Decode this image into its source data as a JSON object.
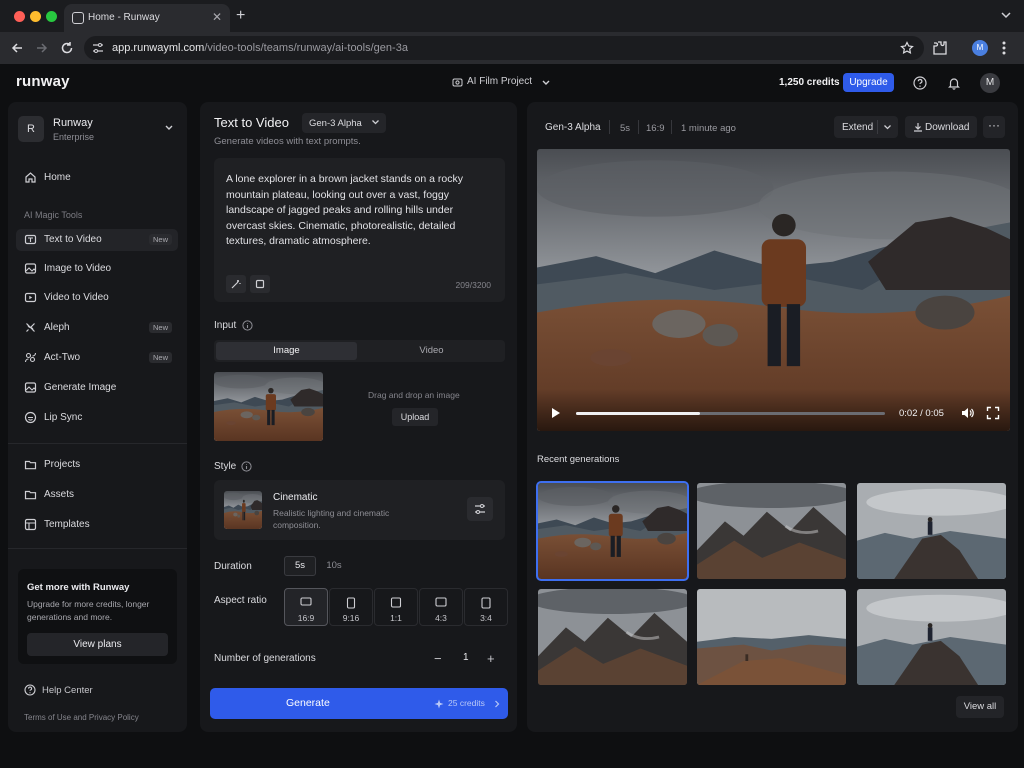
{
  "browser": {
    "tab_title": "Home - Runway",
    "url_host": "app.runwayml.com",
    "url_path": "/video-tools/teams/runway/ai-tools/gen-3a",
    "profile_initial": "M"
  },
  "header": {
    "logo": "runway",
    "project": "AI Film Project",
    "credits": "1,250 credits",
    "upgrade_label": "Upgrade",
    "avatar_initial": "M"
  },
  "sidebar": {
    "workspace_initial": "R",
    "workspace_name": "Runway",
    "workspace_plan": "Enterprise",
    "home_label": "Home",
    "section_label": "AI Magic Tools",
    "tools": [
      {
        "label": "Text to Video",
        "badge": "New",
        "active": true,
        "icon": "text-video-icon"
      },
      {
        "label": "Image to Video",
        "badge": "",
        "active": false,
        "icon": "image-icon"
      },
      {
        "label": "Video to Video",
        "badge": "",
        "active": false,
        "icon": "video-icon"
      },
      {
        "label": "Aleph",
        "badge": "New",
        "active": false,
        "icon": "aleph-icon"
      },
      {
        "label": "Act-Two",
        "badge": "New",
        "active": false,
        "icon": "act-two-icon"
      },
      {
        "label": "Generate Image",
        "badge": "",
        "active": false,
        "icon": "image-icon"
      },
      {
        "label": "Lip Sync",
        "badge": "",
        "active": false,
        "icon": "lip-sync-icon"
      }
    ],
    "library": [
      {
        "label": "Projects",
        "icon": "folder-icon"
      },
      {
        "label": "Assets",
        "icon": "folder-icon"
      },
      {
        "label": "Templates",
        "icon": "template-icon"
      }
    ],
    "promo": {
      "title": "Get more with Runway",
      "text": "Upgrade for more credits, longer generations and more.",
      "button": "View plans"
    },
    "help_label": "Help Center",
    "terms": "Terms of Use and Privacy Policy"
  },
  "panel": {
    "title": "Text to Video",
    "model": "Gen-3 Alpha",
    "subtitle": "Generate videos with text prompts.",
    "prompt": "A lone explorer in a brown jacket stands on a rocky mountain plateau, looking out over a vast, foggy landscape of jagged peaks and rolling hills under overcast skies. Cinematic, photorealistic, detailed textures, dramatic atmosphere.",
    "prompt_count": "209/3200",
    "input_label": "Input",
    "input_tabs": [
      "Image",
      "Video"
    ],
    "drop_text": "Drag and drop an image",
    "upload_label": "Upload",
    "style_label": "Style",
    "style_name": "Cinematic",
    "style_desc": "Realistic lighting and cinematic composition.",
    "duration_label": "Duration",
    "durations": [
      "5s",
      "10s"
    ],
    "aspect_label": "Aspect ratio",
    "aspect_ratios": [
      "16:9",
      "9:16",
      "1:1",
      "4:3",
      "3:4"
    ],
    "ngen_label": "Number of generations",
    "ngen_minus": "−",
    "ngen_value": "1",
    "ngen_plus": "+",
    "generate_label": "Generate",
    "generate_credits": "25 credits"
  },
  "preview": {
    "model": "Gen-3 Alpha",
    "duration": "5s",
    "ratio": "16:9",
    "time_ago": "1 minute ago",
    "extend_label": "Extend",
    "download_label": "Download",
    "more_label": "···",
    "player_time": "0:02 / 0:05",
    "progress": 0.4,
    "recent_label": "Recent generations",
    "view_all": "View all"
  },
  "colors": {
    "accent": "#2f5bea",
    "selected_outline": "#3e6ff0"
  }
}
